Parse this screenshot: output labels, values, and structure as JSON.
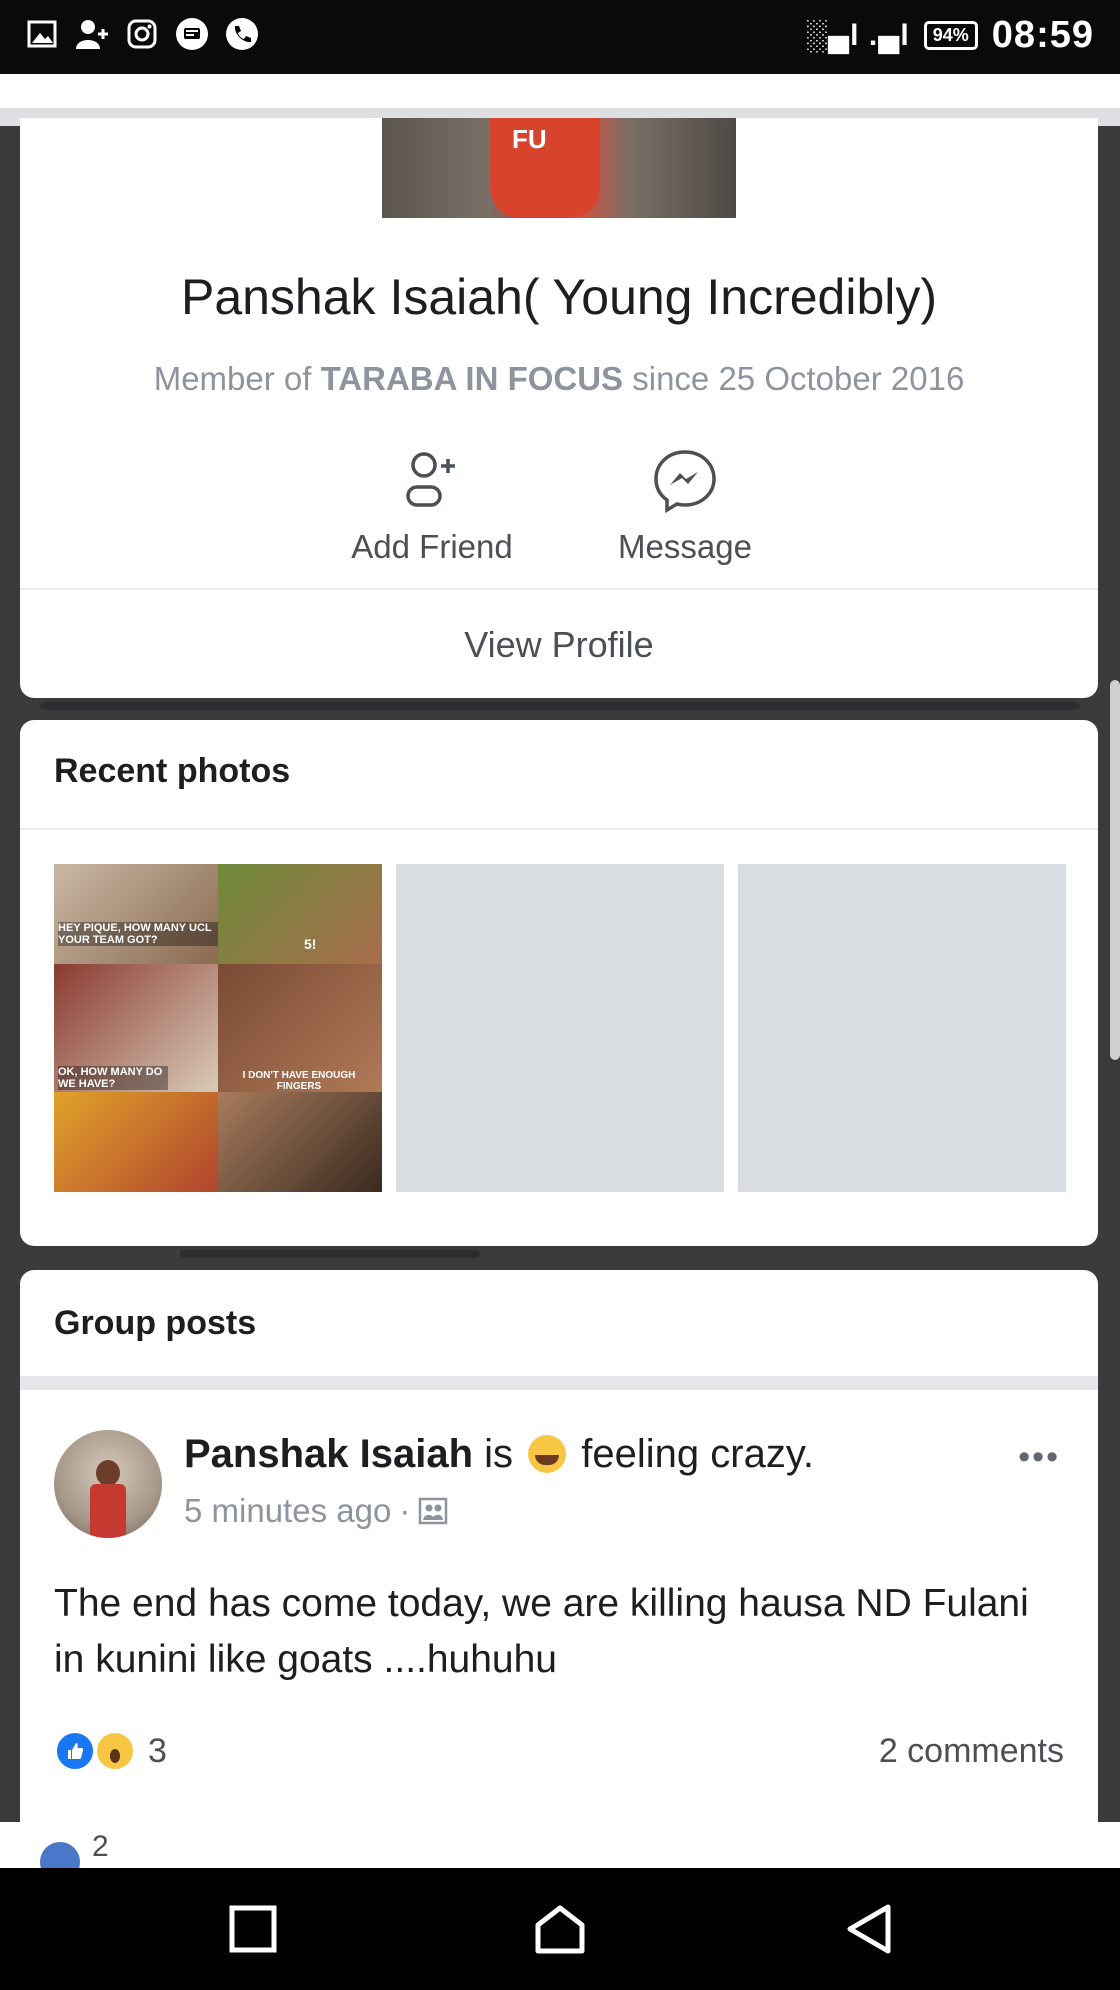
{
  "status_bar": {
    "time": "08:59",
    "battery": "94%",
    "signal": "░▄l .▄l",
    "left_icons": [
      "image-icon",
      "person-add-icon",
      "instagram-icon",
      "message-icon",
      "phone-icon"
    ]
  },
  "profile_card": {
    "name": "Panshak Isaiah( Young Incredibly)",
    "member_prefix": "Member of ",
    "group_name": "TARABA IN FOCUS",
    "member_suffix": " since 25 October 2016",
    "add_friend_label": "Add Friend",
    "message_label": "Message",
    "view_profile_label": "View Profile"
  },
  "recent_photos": {
    "title": "Recent photos",
    "meme_texts": [
      "HEY PIQUE, HOW MANY UCL YOUR TEAM GOT?",
      "5!",
      "OK, HOW MANY DO WE HAVE?",
      "I DON'T HAVE ENOUGH FINGERS"
    ]
  },
  "group_posts": {
    "title": "Group posts",
    "post": {
      "author": "Panshak Isaiah",
      "verb": " is ",
      "feeling": "feeling crazy.",
      "time": "5 minutes ago",
      "separator": "·",
      "text": "The end has come today, we are  killing hausa ND Fulani in kunini like goats ....huhuhu",
      "reaction_count": "3",
      "comments": "2 comments"
    }
  },
  "below": {
    "partial_count": "2"
  },
  "colors": {
    "accent": "#1877f2",
    "meta_gray": "#8d949e",
    "status_bar": "#0a0a0a"
  }
}
